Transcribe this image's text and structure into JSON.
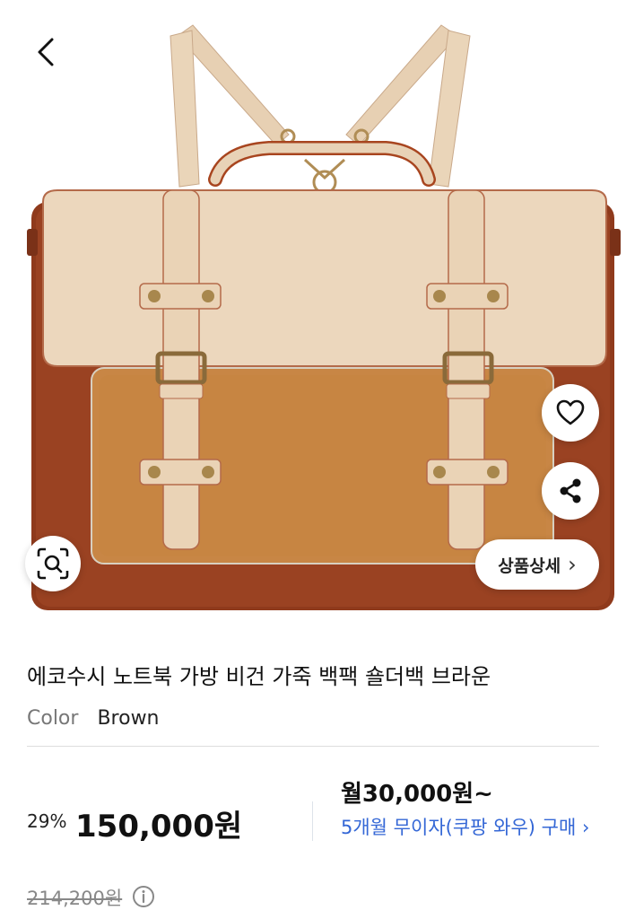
{
  "product": {
    "title": "에코수시 노트북 가방 비건 가죽 백팩 숄더백 브라운",
    "option_label": "Color",
    "option_value": "Brown"
  },
  "hero": {
    "detail_button_label": "상품상세",
    "detail_chevron": "›"
  },
  "price": {
    "discount": "29%",
    "sale": "150,000원",
    "original": "214,200원",
    "monthly": "월30,000원~",
    "installment": "5개월 무이자(쿠팡 와우) 구매 ›"
  },
  "icons": {
    "back": "chevron-left-icon",
    "wishlist": "heart-icon",
    "share": "share-icon",
    "image_search": "search-lens-icon",
    "info": "info-icon"
  },
  "colors": {
    "link_blue": "#3467d6",
    "bag_cream": "#ecd7bd",
    "bag_tan": "#c88645",
    "bag_brown": "#8f3a1c"
  }
}
